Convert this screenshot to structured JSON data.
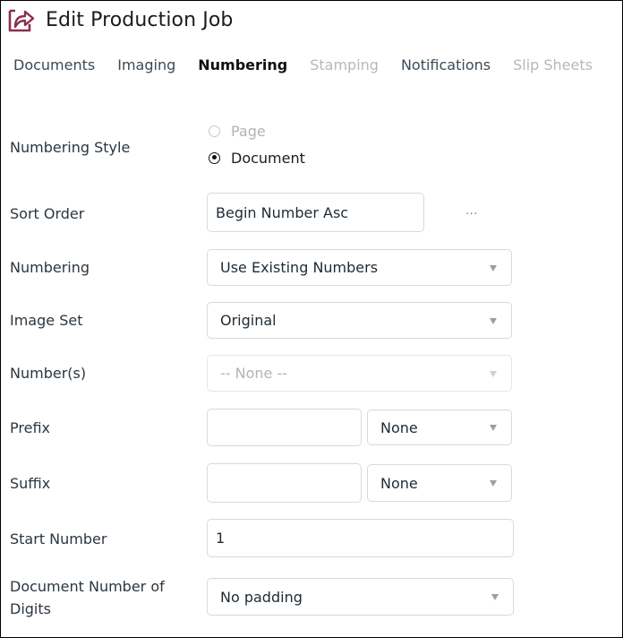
{
  "header": {
    "title": "Edit Production Job",
    "icon": "share-arrow-icon",
    "icon_color": "#8b2e4f"
  },
  "tabs": [
    {
      "label": "Documents",
      "state": "normal"
    },
    {
      "label": "Imaging",
      "state": "normal"
    },
    {
      "label": "Numbering",
      "state": "active"
    },
    {
      "label": "Stamping",
      "state": "disabled"
    },
    {
      "label": "Notifications",
      "state": "normal"
    },
    {
      "label": "Slip Sheets",
      "state": "disabled"
    }
  ],
  "form": {
    "numbering_style": {
      "label": "Numbering Style",
      "options": [
        {
          "label": "Page",
          "selected": false,
          "disabled": true
        },
        {
          "label": "Document",
          "selected": true,
          "disabled": false
        }
      ]
    },
    "sort_order": {
      "label": "Sort Order",
      "value": "Begin Number Asc",
      "more_label": "..."
    },
    "numbering": {
      "label": "Numbering",
      "value": "Use Existing Numbers"
    },
    "image_set": {
      "label": "Image Set",
      "value": "Original"
    },
    "numbers": {
      "label": "Number(s)",
      "value": "-- None --",
      "disabled": true
    },
    "prefix": {
      "label": "Prefix",
      "value": "",
      "select_value": "None"
    },
    "suffix": {
      "label": "Suffix",
      "value": "",
      "select_value": "None"
    },
    "start_number": {
      "label": "Start Number",
      "value": "1"
    },
    "doc_number_digits": {
      "label": "Document Number of Digits",
      "value": "No padding"
    }
  }
}
